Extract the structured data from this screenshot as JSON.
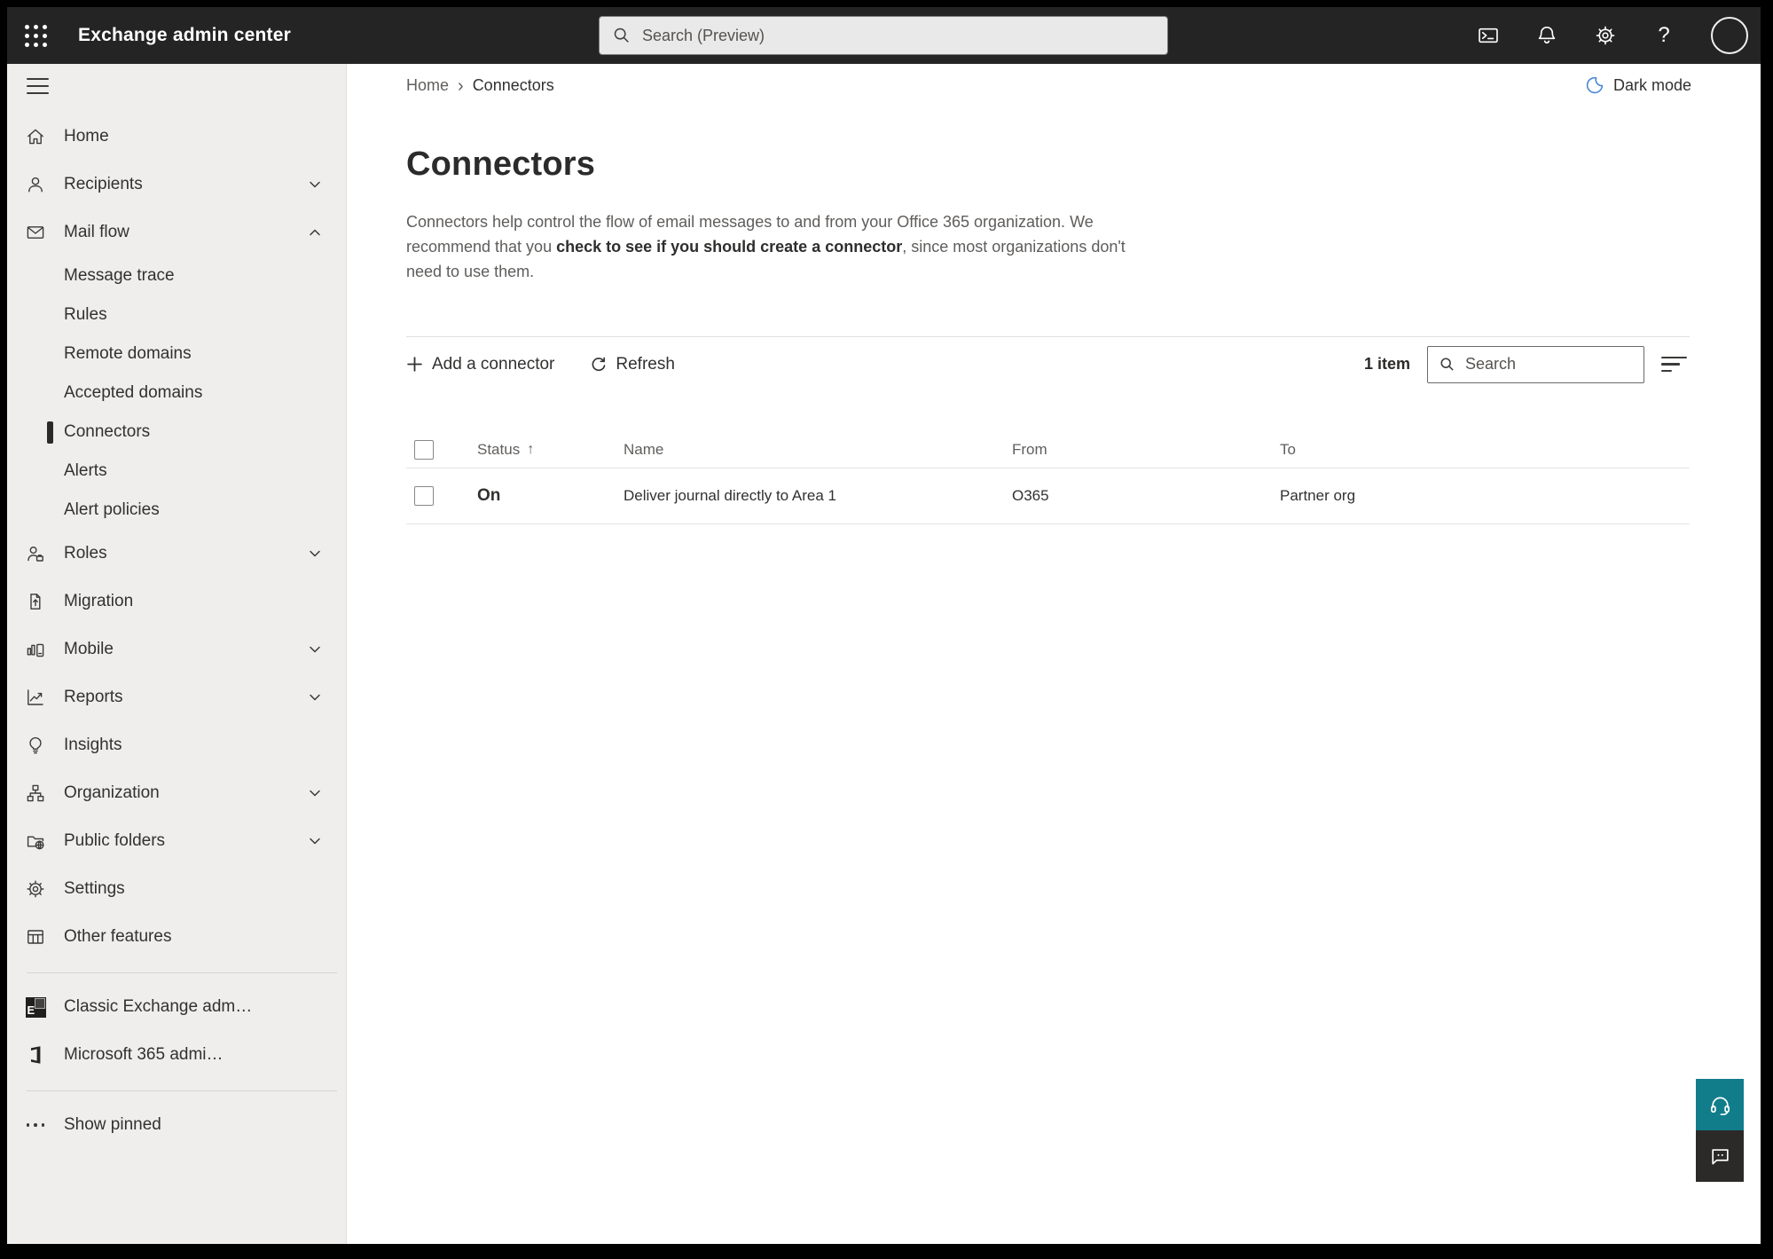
{
  "topbar": {
    "title": "Exchange admin center",
    "search_placeholder": "Search (Preview)",
    "help_glyph": "?"
  },
  "breadcrumb": {
    "home": "Home",
    "separator": "›",
    "current": "Connectors"
  },
  "header": {
    "dark_mode_label": "Dark mode"
  },
  "page": {
    "title": "Connectors",
    "description_pre": "Connectors help control the flow of email messages to and from your Office 365 organization. We recommend that you ",
    "description_emphasis": "check to see if you should create a connector",
    "description_post": ", since most organizations don't need to use them."
  },
  "toolbar": {
    "add_label": "Add a connector",
    "refresh_label": "Refresh",
    "item_count": "1 item",
    "search_placeholder": "Search"
  },
  "table": {
    "columns": {
      "status": "Status",
      "name": "Name",
      "from": "From",
      "to": "To"
    },
    "sort_glyph": "↑",
    "rows": [
      {
        "status": "On",
        "name": "Deliver journal directly to Area 1",
        "from": "O365",
        "to": "Partner org"
      }
    ]
  },
  "sidebar": {
    "items": [
      {
        "label": "Home"
      },
      {
        "label": "Recipients"
      },
      {
        "label": "Mail flow"
      },
      {
        "label": "Message trace"
      },
      {
        "label": "Rules"
      },
      {
        "label": "Remote domains"
      },
      {
        "label": "Accepted domains"
      },
      {
        "label": "Connectors",
        "selected": true
      },
      {
        "label": "Alerts"
      },
      {
        "label": "Alert policies"
      },
      {
        "label": "Roles"
      },
      {
        "label": "Migration"
      },
      {
        "label": "Mobile"
      },
      {
        "label": "Reports"
      },
      {
        "label": "Insights"
      },
      {
        "label": "Organization"
      },
      {
        "label": "Public folders"
      },
      {
        "label": "Settings"
      },
      {
        "label": "Other features"
      },
      {
        "label": "Classic Exchange adm…"
      },
      {
        "label": "Microsoft 365 admi…"
      },
      {
        "label": "Show pinned"
      }
    ]
  },
  "icons": {
    "classic_exchange_glyph": "E"
  },
  "colors": {
    "topbar_bg": "#242424",
    "sidebar_bg": "#efeeec",
    "accent_teal": "#117d8b",
    "feedback_dark": "#2b2a28",
    "moon_blue": "#4a86d8",
    "selected_indicator": "#2b2a29"
  }
}
